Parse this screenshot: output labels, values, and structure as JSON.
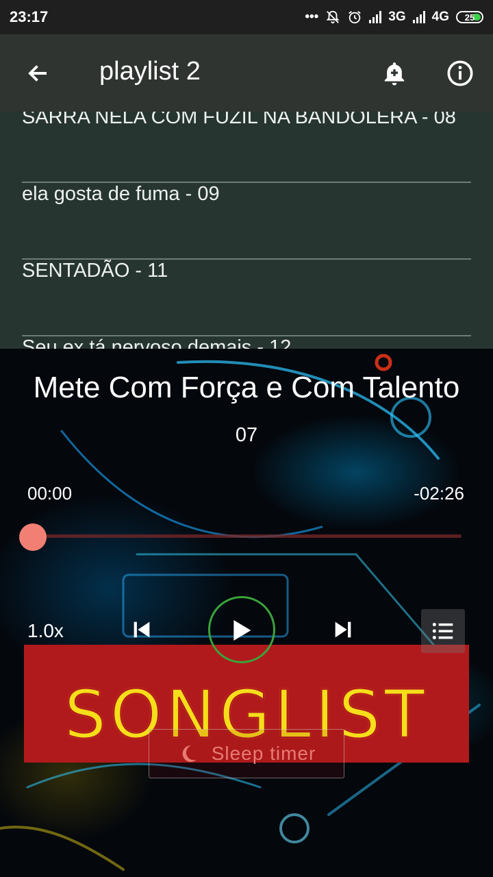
{
  "status": {
    "time": "23:17",
    "net1": "3G",
    "net2": "4G",
    "battery": "25"
  },
  "appbar": {
    "title": "playlist 2",
    "back_icon": "arrow-left-icon",
    "alarm_icon": "add-alarm-icon",
    "info_icon": "info-icon"
  },
  "playlist": {
    "items": [
      {
        "label": "SARRA NELA COM FUZIL NA BANDOLERA - 08"
      },
      {
        "label": "ela gosta de fuma - 09"
      },
      {
        "label": "SENTADÃO - 11"
      },
      {
        "label": "Seu ex tá nervoso demais - 12"
      }
    ]
  },
  "player": {
    "title": "Mete Com Força e Com Talento",
    "track_number": "07",
    "elapsed": "00:00",
    "remaining": "-02:26",
    "progress": 0,
    "speed": "1.0x",
    "banner": "SONGLIST",
    "sleep_timer": "Sleep timer"
  },
  "colors": {
    "appbar": "#2f3431",
    "list_bg": "#273530",
    "seek_thumb": "#f27f73",
    "play_ring": "#3aa43b",
    "banner_bg": "#b11a1c",
    "banner_text": "#f5de1a"
  }
}
